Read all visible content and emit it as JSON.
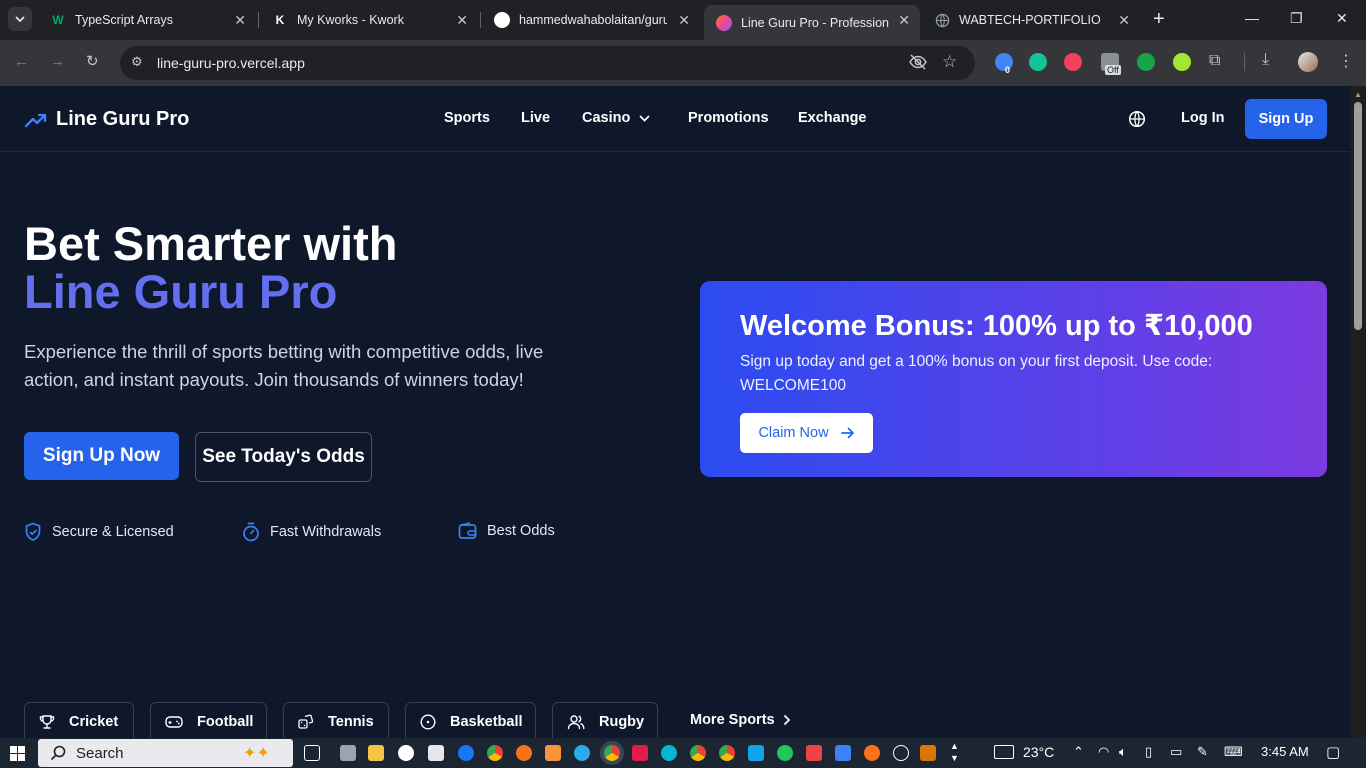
{
  "browser": {
    "tabs": [
      {
        "title": "TypeScript Arrays",
        "favicon": "w3schools-icon",
        "active": false
      },
      {
        "title": "My Kworks - Kwork",
        "favicon": "kwork-icon",
        "active": false
      },
      {
        "title": "hammedwahabolaitan/guru",
        "favicon": "github-icon",
        "active": false
      },
      {
        "title": "Line Guru Pro - Professional",
        "favicon": "lineguru-icon",
        "active": true
      },
      {
        "title": "WABTECH-PORTIFOLIO",
        "favicon": "globe-icon",
        "active": false
      }
    ],
    "new_tab": "+",
    "url": "line-guru-pro.vercel.app",
    "ext_badge": "0",
    "ext_off": "Off"
  },
  "site": {
    "logo": "Line Guru Pro",
    "nav": [
      "Sports",
      "Live",
      "Casino",
      "Promotions",
      "Exchange"
    ],
    "login": "Log In",
    "signup": "Sign Up"
  },
  "hero": {
    "title_line1": "Bet Smarter with",
    "title_line2": "Line Guru Pro",
    "subtitle": "Experience the thrill of sports betting with competitive odds, live action, and instant payouts. Join thousands of winners today!",
    "primary_cta": "Sign Up Now",
    "secondary_cta": "See Today's Odds",
    "features": [
      "Secure & Licensed",
      "Fast Withdrawals",
      "Best Odds"
    ]
  },
  "bonus": {
    "title": "Welcome Bonus: 100% up to ₹10,000",
    "text": "Sign up today and get a 100% bonus on your first deposit. Use code: WELCOME100",
    "cta": "Claim Now"
  },
  "sports": [
    "Cricket",
    "Football",
    "Tennis",
    "Basketball",
    "Rugby"
  ],
  "more_sports": "More Sports",
  "taskbar": {
    "search_placeholder": "Search",
    "weather": "23°C",
    "time": "3:45 AM"
  },
  "colors": {
    "page_bg": "#0f172a",
    "accent": "#2563eb",
    "highlight": "#6270f0",
    "bonus_gradient_start": "#2b4cf0",
    "bonus_gradient_end": "#7c3adf"
  }
}
